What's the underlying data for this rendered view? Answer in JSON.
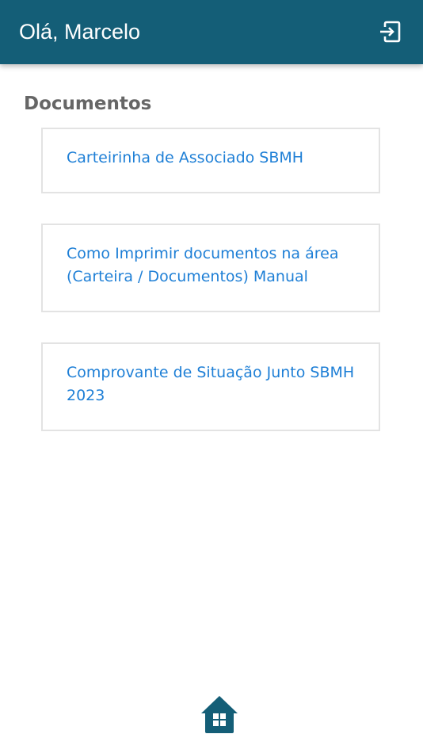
{
  "header": {
    "greeting": "Olá, Marcelo",
    "logout_icon": "logout-icon",
    "background_color": "#145e77"
  },
  "documents": {
    "title": "Documentos",
    "items": [
      {
        "label": "Carteirinha de Associado SBMH"
      },
      {
        "label": "Como Imprimir documentos na área (Carteira / Documentos) Manual"
      },
      {
        "label": "Comprovante de Situação Junto SBMH 2023"
      }
    ],
    "link_color": "#1e7fd6"
  },
  "bottom_nav": {
    "home_icon": "home-icon"
  }
}
